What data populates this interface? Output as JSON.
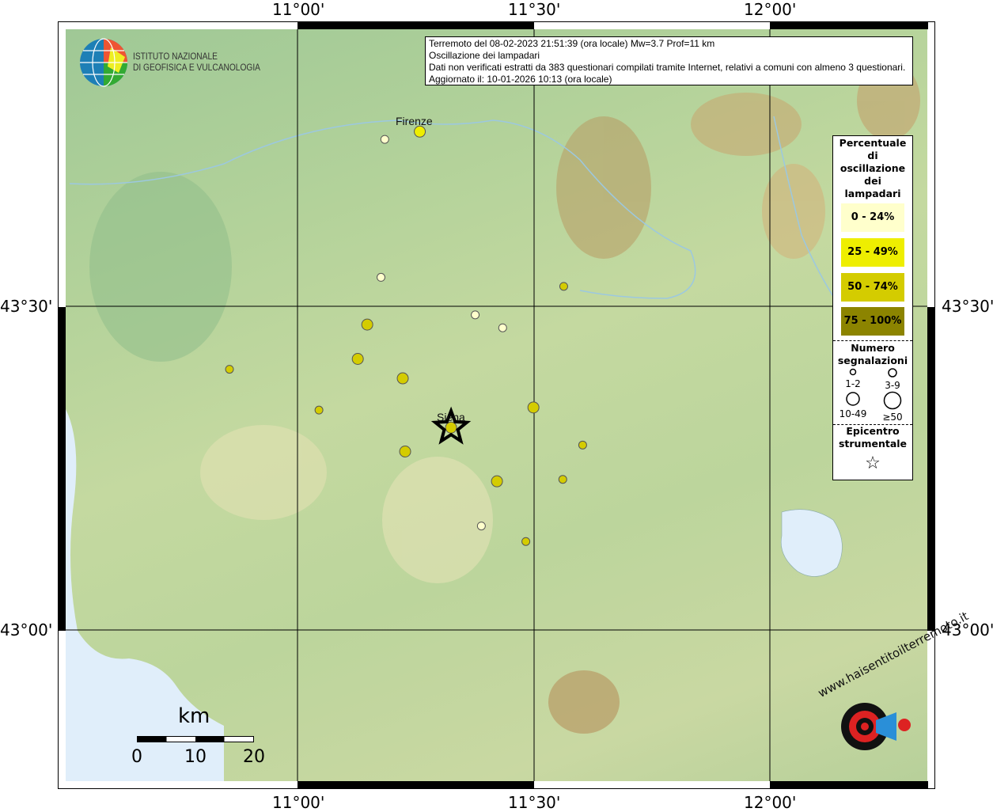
{
  "info": {
    "line1": "Terremoto del 08-02-2023 21:51:39 (ora locale) Mw=3.7 Prof=11 km",
    "line2": "Oscillazione dei lampadari",
    "line3": "Dati non verificati estratti da 383 questionari compilati tramite Internet, relativi a comuni con almeno 3 questionari.",
    "line4": "Aggiornato il: 10-01-2026 10:13 (ora locale)"
  },
  "logo_ingv": {
    "line1": "ISTITUTO NAZIONALE",
    "line2": "DI GEOFISICA E VULCANOLOGIA"
  },
  "logo_hsit": "www.haisentitoilterremoto.it",
  "axes": {
    "lon_ticks": [
      "11°00'",
      "11°30'",
      "12°00'"
    ],
    "lat_ticks": [
      "43°30'",
      "43°00'"
    ],
    "lon_values": [
      11.0,
      11.5,
      12.0
    ],
    "lat_values": [
      43.5,
      43.0
    ],
    "lon_range": [
      10.51,
      12.33
    ],
    "lat_range": [
      42.767,
      43.928
    ]
  },
  "cities": [
    {
      "name": "Firenze",
      "lon": 11.255,
      "lat": 43.79
    },
    {
      "name": "Siena",
      "lon": 11.33,
      "lat": 43.32
    }
  ],
  "legend": {
    "title": "Percentuale di oscillazione dei lampadari",
    "classes": [
      {
        "label": "0 - 24%",
        "color": "#ffffcc"
      },
      {
        "label": "25 - 49%",
        "color": "#eeee00"
      },
      {
        "label": "50 - 74%",
        "color": "#d4cc00"
      },
      {
        "label": "75 - 100%",
        "color": "#8c8400"
      }
    ],
    "count_title": "Numero segnalazioni",
    "counts": [
      "1-2",
      "3-9",
      "10-49",
      "≥50"
    ],
    "epi_title": "Epicentro strumentale"
  },
  "scale": {
    "unit": "km",
    "labels": [
      "0",
      "10",
      "20"
    ]
  },
  "epicenter": {
    "lon": 11.324,
    "lat": 43.313
  },
  "points": [
    {
      "lon": 11.184,
      "lat": 43.758,
      "cls": 0,
      "n": 0
    },
    {
      "lon": 11.258,
      "lat": 43.77,
      "cls": 1,
      "n": 1
    },
    {
      "lon": 11.176,
      "lat": 43.545,
      "cls": 0,
      "n": 0
    },
    {
      "lon": 11.562,
      "lat": 43.531,
      "cls": 2,
      "n": 0
    },
    {
      "lon": 11.375,
      "lat": 43.487,
      "cls": 0,
      "n": 0
    },
    {
      "lon": 11.433,
      "lat": 43.467,
      "cls": 0,
      "n": 0
    },
    {
      "lon": 11.147,
      "lat": 43.472,
      "cls": 2,
      "n": 1
    },
    {
      "lon": 11.127,
      "lat": 43.419,
      "cls": 2,
      "n": 1
    },
    {
      "lon": 10.856,
      "lat": 43.403,
      "cls": 2,
      "n": 0
    },
    {
      "lon": 11.222,
      "lat": 43.389,
      "cls": 2,
      "n": 1
    },
    {
      "lon": 11.045,
      "lat": 43.34,
      "cls": 2,
      "n": 0
    },
    {
      "lon": 11.498,
      "lat": 43.344,
      "cls": 2,
      "n": 1
    },
    {
      "lon": 11.227,
      "lat": 43.276,
      "cls": 2,
      "n": 1
    },
    {
      "lon": 11.602,
      "lat": 43.286,
      "cls": 2,
      "n": 0
    },
    {
      "lon": 11.421,
      "lat": 43.23,
      "cls": 2,
      "n": 1
    },
    {
      "lon": 11.56,
      "lat": 43.233,
      "cls": 2,
      "n": 0
    },
    {
      "lon": 11.388,
      "lat": 43.161,
      "cls": 0,
      "n": 0
    },
    {
      "lon": 11.482,
      "lat": 43.137,
      "cls": 2,
      "n": 0
    },
    {
      "lon": 11.324,
      "lat": 43.313,
      "cls": 2,
      "n": 1
    }
  ]
}
